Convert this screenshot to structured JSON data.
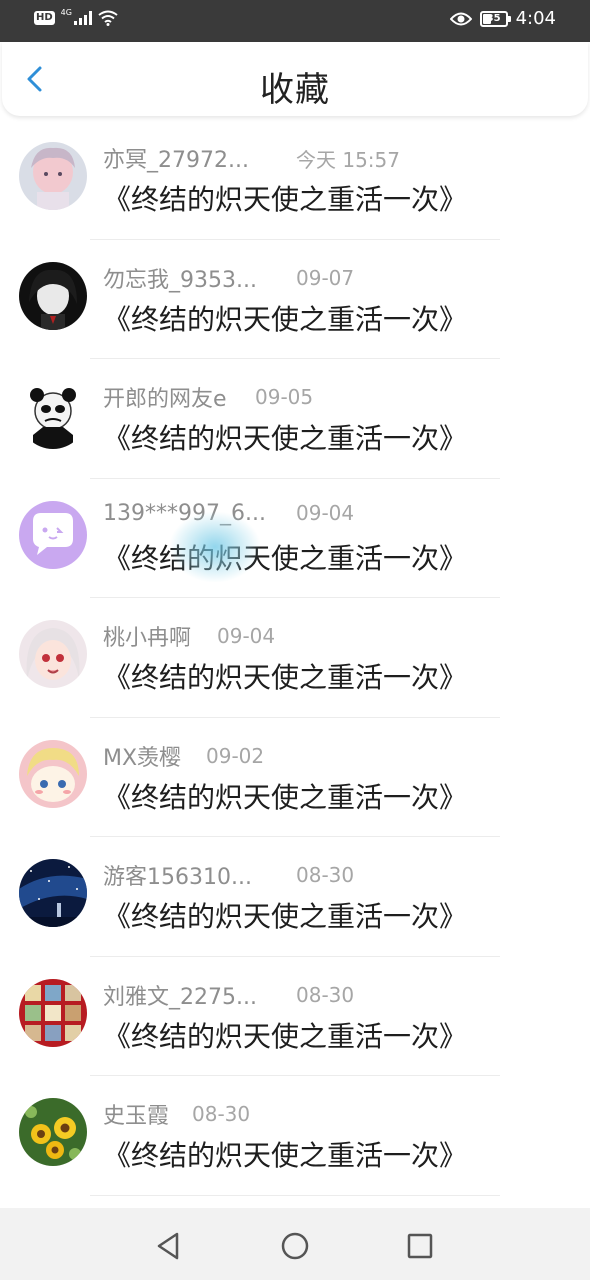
{
  "status_bar": {
    "hd": "HD",
    "network": "4G",
    "eye_icon": "eye-icon",
    "battery": "35",
    "time": "4:04"
  },
  "header": {
    "back_icon": "chevron-left-icon",
    "title": "收藏"
  },
  "favorites": [
    {
      "user": "亦冥_27972...",
      "time": "今天 15:57",
      "title": "《终结的炽天使之重活一次》",
      "avatar": "anime-boy-pink"
    },
    {
      "user": "勿忘我_9353...",
      "time": "09-07",
      "title": "《终结的炽天使之重活一次》",
      "avatar": "dark-anime-girl"
    },
    {
      "user": "开郎的网友e",
      "time": "09-05",
      "title": "《终结的炽天使之重活一次》",
      "avatar": "panda-meme"
    },
    {
      "user": "139***997_6...",
      "time": "09-04",
      "title": "《终结的炽天使之重活一次》",
      "avatar": "chat-bubble-purple"
    },
    {
      "user": "桃小冉啊",
      "time": "09-04",
      "title": "《终结的炽天使之重活一次》",
      "avatar": "anime-girl-white-hair"
    },
    {
      "user": "MX羡樱",
      "time": "09-02",
      "title": "《终结的炽天使之重活一次》",
      "avatar": "cartoon-blonde-pink"
    },
    {
      "user": "游客156310...",
      "time": "08-30",
      "title": "《终结的炽天使之重活一次》",
      "avatar": "starry-night"
    },
    {
      "user": "刘雅文_2275...",
      "time": "08-30",
      "title": "《终结的炽天使之重活一次》",
      "avatar": "stamp-collage-red"
    },
    {
      "user": "史玉霞",
      "time": "08-30",
      "title": "《终结的炽天使之重活一次》",
      "avatar": "sunflowers"
    }
  ],
  "nav_bar": {
    "back": "triangle-back-icon",
    "home": "circle-home-icon",
    "recents": "square-recents-icon"
  },
  "colors": {
    "status_bar_bg": "#3a3a3a",
    "accent": "#2f8fd8",
    "username": "#8e8e8e",
    "title_text": "#1e1e1e",
    "nav_bg": "#f2f2f2"
  }
}
